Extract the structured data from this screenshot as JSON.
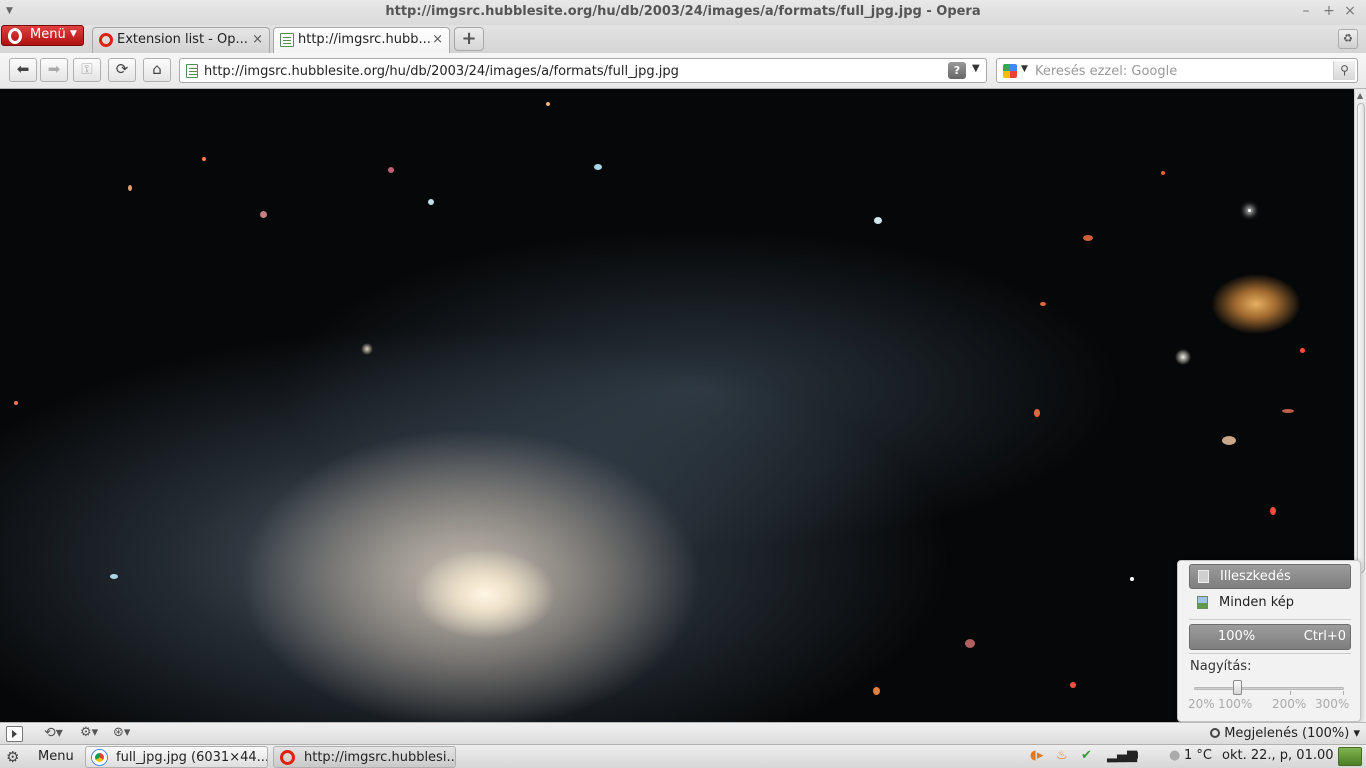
{
  "window": {
    "title": "http://imgsrc.hubblesite.org/hu/db/2003/24/images/a/formats/full_jpg.jpg - Opera"
  },
  "tabbar": {
    "menu_label": "Menü",
    "tabs": [
      {
        "label": "Extension list - Op..."
      },
      {
        "label": "http://imgsrc.hubb..."
      }
    ]
  },
  "toolbar": {
    "url": "http://imgsrc.hubblesite.org/hu/db/2003/24/images/a/formats/full_jpg.jpg",
    "search_placeholder": "Keresés ezzel: Google",
    "help_label": "?"
  },
  "zoom_popup": {
    "fit_label": "Illeszkedés",
    "all_images_label": "Minden kép",
    "reset_value": "100%",
    "reset_shortcut": "Ctrl+0",
    "zoom_label": "Nagyítás:",
    "zoom_level": 1.0,
    "tick_labels": [
      "20%",
      "100%",
      "200%",
      "300%"
    ]
  },
  "statusbar": {
    "view_label": "Megjelenés (100%)"
  },
  "taskbar": {
    "menu_label": "Menu",
    "tasks": [
      {
        "label": "full_jpg.jpg (6031×44..."
      },
      {
        "label": "http://imgsrc.hubblesi..."
      }
    ],
    "temperature": "1 °C",
    "datetime": "okt. 22., p, 01.00"
  }
}
